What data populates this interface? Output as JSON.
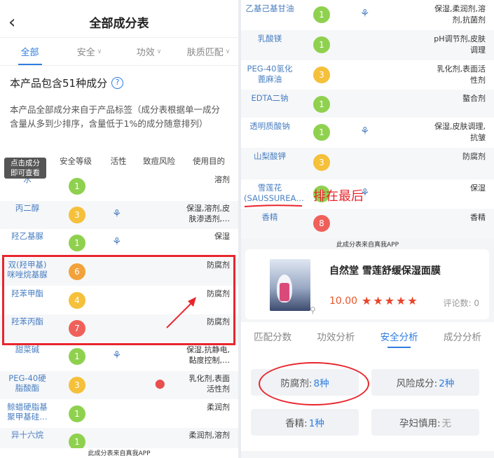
{
  "left": {
    "title": "全部成分表",
    "tabs": [
      {
        "label": "全部",
        "active": true
      },
      {
        "label": "安全",
        "active": false
      },
      {
        "label": "功效",
        "active": false
      },
      {
        "label": "肤质匹配",
        "active": false
      }
    ],
    "count_text": "本产品包含51种成分",
    "description": "本产品全部成分来自于产品标签（成分表根据单一成分含量从多到少排序，含量低于1%的成分随意排列）",
    "headers": {
      "level": "安全等级",
      "activity": "活性",
      "acne": "致痘风险",
      "use": "使用目的"
    },
    "tooltip": "点击成分\n即可查看",
    "rows": [
      {
        "name": "水",
        "level": "1",
        "color": "green",
        "active": false,
        "acne": false,
        "use": "溶剂"
      },
      {
        "name": "丙二醇",
        "level": "3",
        "color": "yellow",
        "active": true,
        "acne": false,
        "use": "保湿,溶剂,皮肤渗透剂,…"
      },
      {
        "name": "羟乙基脲",
        "level": "1",
        "color": "green",
        "active": true,
        "acne": false,
        "use": "保湿"
      },
      {
        "name": "双(羟甲基)咪唑烷基脲",
        "level": "6",
        "color": "orange",
        "active": false,
        "acne": false,
        "use": "防腐剂"
      },
      {
        "name": "羟苯甲酯",
        "level": "4",
        "color": "yellow",
        "active": false,
        "acne": false,
        "use": "防腐剂"
      },
      {
        "name": "羟苯丙酯",
        "level": "7",
        "color": "red",
        "active": false,
        "acne": false,
        "use": "防腐剂"
      },
      {
        "name": "甜菜碱",
        "level": "1",
        "color": "green",
        "active": true,
        "acne": false,
        "use": "保湿,抗静电,黏度控制,…"
      },
      {
        "name": "PEG-40硬脂酸酯",
        "level": "3",
        "color": "yellow",
        "active": false,
        "acne": true,
        "use": "乳化剂,表面活性剂"
      },
      {
        "name": "鲸蜡硬脂基聚甲基硅…",
        "level": "1",
        "color": "green",
        "active": false,
        "acne": false,
        "use": "柔润剂"
      },
      {
        "name": "异十六烷",
        "level": "1",
        "color": "green",
        "active": false,
        "acne": false,
        "use": "柔润剂,溶剂"
      }
    ],
    "footer": "此成分表来自真我APP"
  },
  "right": {
    "rows": [
      {
        "name": "乙基己基甘油",
        "level": "1",
        "color": "green",
        "active": true,
        "use": "保湿,柔润剂,溶剂,抗菌剂"
      },
      {
        "name": "乳酸镁",
        "level": "1",
        "color": "green",
        "active": false,
        "use": "pH调节剂,皮肤调理"
      },
      {
        "name": "PEG-40氢化蓖麻油",
        "level": "3",
        "color": "yellow",
        "active": false,
        "use": "乳化剂,表面活性剂"
      },
      {
        "name": "EDTA二钠",
        "level": "1",
        "color": "green",
        "active": false,
        "use": "螯合剂"
      },
      {
        "name": "透明质酸钠",
        "level": "1",
        "color": "green",
        "active": true,
        "use": "保湿,皮肤调理,抗皱"
      },
      {
        "name": "山梨酸钾",
        "level": "3",
        "color": "yellow",
        "active": false,
        "use": "防腐剂"
      },
      {
        "name": "雪莲花(SAUSSUREA…",
        "level": "1",
        "color": "green",
        "active": true,
        "use": "保湿"
      },
      {
        "name": "香精",
        "level": "8",
        "color": "red",
        "active": false,
        "use": "香精"
      }
    ],
    "annotation": "排在最后",
    "watermark": "此成分表来自真我APP",
    "product": {
      "name": "自然堂 雪莲舒缓保湿面膜",
      "price": "10.00",
      "stars": "★★★★★",
      "reviews": "评论数: 0"
    },
    "tabs": [
      {
        "label": "匹配分数",
        "active": false
      },
      {
        "label": "功效分析",
        "active": false
      },
      {
        "label": "安全分析",
        "active": true
      },
      {
        "label": "成分分析",
        "active": false
      }
    ],
    "stats": {
      "preservative_label": "防腐剂:",
      "preservative_value": "8种",
      "risk_label": "风险成分:",
      "risk_value": "2种",
      "fragrance_label": "香精:",
      "fragrance_value": "1种",
      "pregnancy_label": "孕妇慎用:",
      "pregnancy_value": "无"
    }
  },
  "colors": {
    "accent": "#2f7de1",
    "annotation_red": "#e8252d",
    "green": "#8fd14f",
    "yellow": "#f5c03a",
    "orange": "#f2a23a",
    "red": "#f0605a"
  }
}
